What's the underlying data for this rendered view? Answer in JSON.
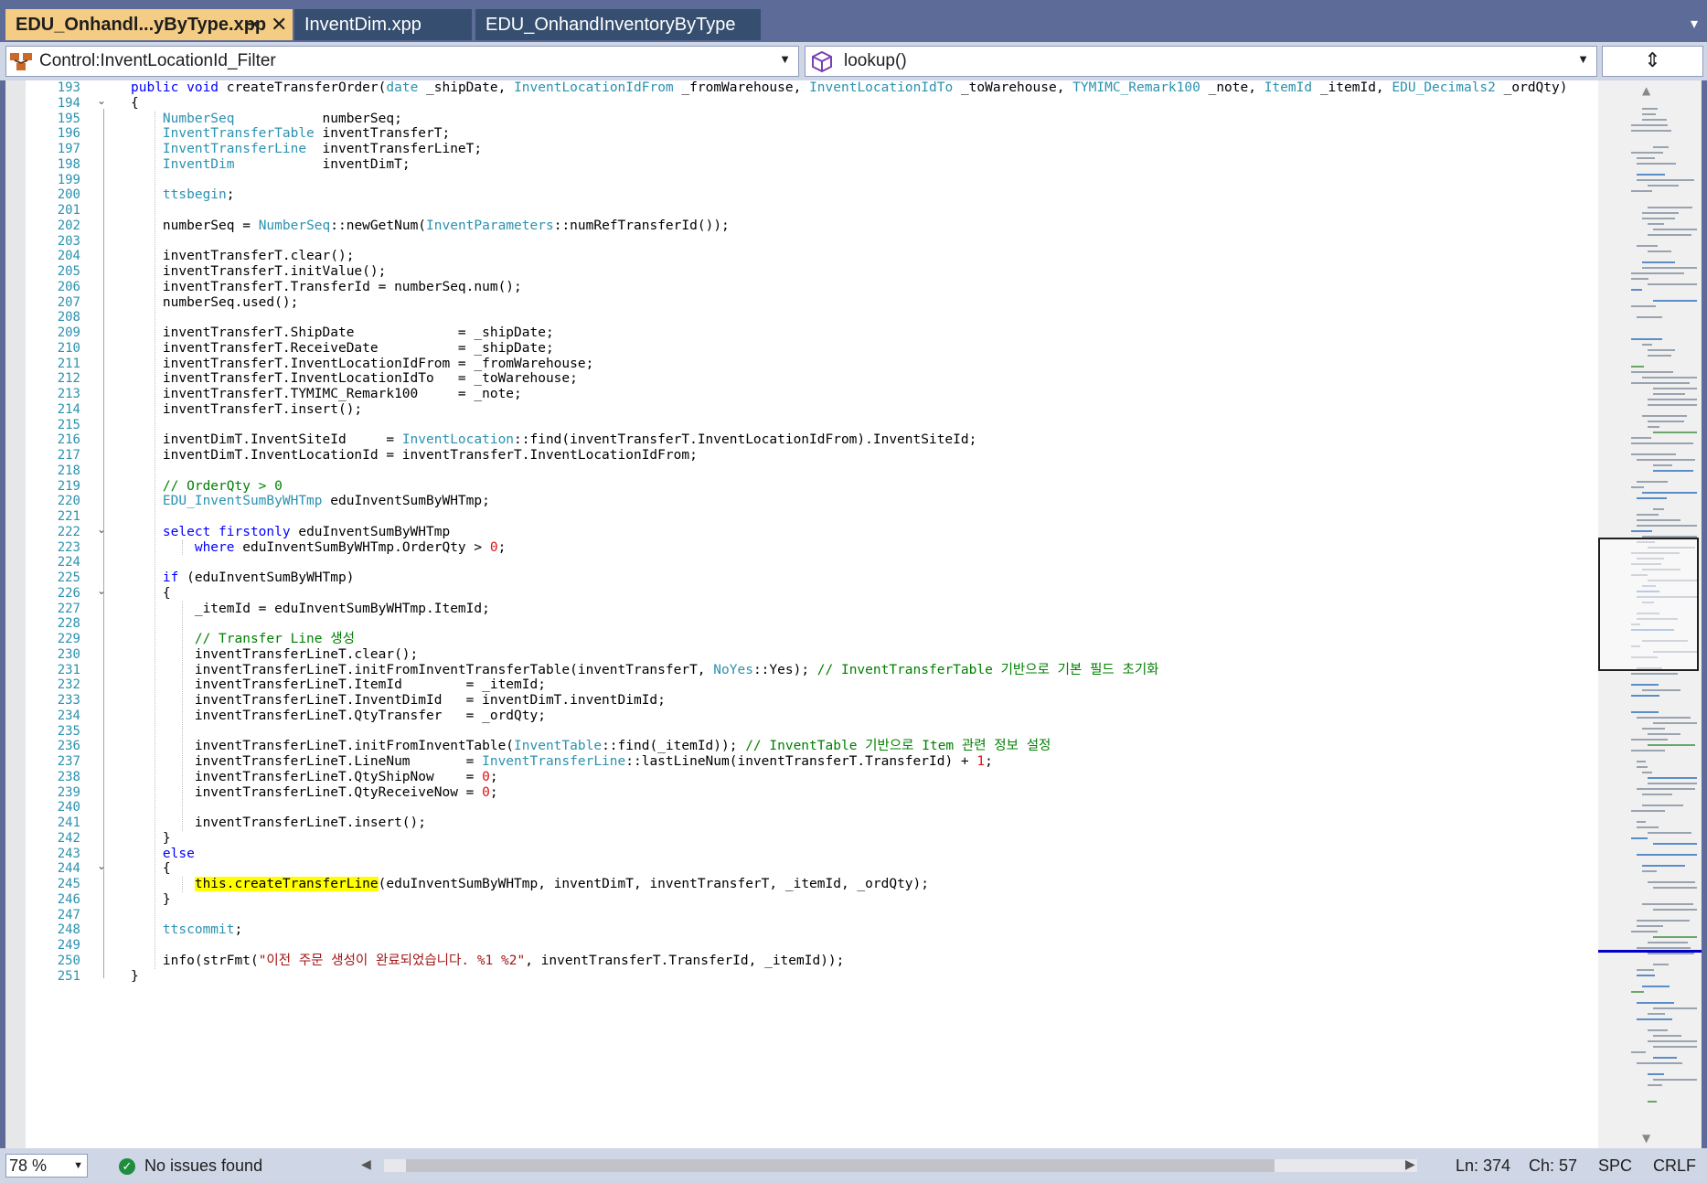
{
  "tabs": [
    {
      "label": "EDU_Onhandl...yByType.xpp",
      "active": true,
      "pin_icon": "pin-icon",
      "close_icon": "close-icon"
    },
    {
      "label": "InventDim.xpp",
      "active": false
    },
    {
      "label": "EDU_OnhandInventoryByType",
      "active": false
    }
  ],
  "nav": {
    "left_combo": "Control:InventLocationId_Filter",
    "right_combo": "lookup()",
    "split_icon": "split-icon"
  },
  "colors": {
    "active_tab": "#f5cc84",
    "tab_strip": "#5d6b99",
    "keyword": "#0000ff",
    "type": "#2b91af",
    "comment": "#008000",
    "string": "#a31515",
    "number": "#e01010",
    "highlight": "#ffff00"
  },
  "code": {
    "first_line_number": 193,
    "lines": [
      [
        [
          "kw",
          "public void "
        ],
        [
          "",
          "createTransferOrder("
        ],
        [
          "ty",
          "date"
        ],
        [
          "",
          " _shipDate, "
        ],
        [
          "ty",
          "InventLocationIdFrom"
        ],
        [
          "",
          " _fromWarehouse, "
        ],
        [
          "ty",
          "InventLocationIdTo"
        ],
        [
          "",
          " _toWarehouse, "
        ],
        [
          "ty",
          "TYMIMC_Remark100"
        ],
        [
          "",
          " _note, "
        ],
        [
          "ty",
          "ItemId"
        ],
        [
          "",
          " _itemId, "
        ],
        [
          "ty",
          "EDU_Decimals2"
        ],
        [
          "",
          " _ordQty)"
        ]
      ],
      [
        [
          "",
          "{"
        ]
      ],
      [
        [
          "",
          "    "
        ],
        [
          "ty",
          "NumberSeq"
        ],
        [
          "",
          "           numberSeq;"
        ]
      ],
      [
        [
          "",
          "    "
        ],
        [
          "ty",
          "InventTransferTable"
        ],
        [
          "",
          " inventTransferT;"
        ]
      ],
      [
        [
          "",
          "    "
        ],
        [
          "ty",
          "InventTransferLine"
        ],
        [
          "",
          "  inventTransferLineT;"
        ]
      ],
      [
        [
          "",
          "    "
        ],
        [
          "ty",
          "InventDim"
        ],
        [
          "",
          "           inventDimT;"
        ]
      ],
      [],
      [
        [
          "",
          "    "
        ],
        [
          "ty",
          "ttsbegin"
        ],
        [
          "",
          ";"
        ]
      ],
      [],
      [
        [
          "",
          "    numberSeq = "
        ],
        [
          "ty",
          "NumberSeq"
        ],
        [
          "",
          "::newGetNum("
        ],
        [
          "ty",
          "InventParameters"
        ],
        [
          "",
          "::numRefTransferId());"
        ]
      ],
      [],
      [
        [
          "",
          "    inventTransferT.clear();"
        ]
      ],
      [
        [
          "",
          "    inventTransferT.initValue();"
        ]
      ],
      [
        [
          "",
          "    inventTransferT.TransferId = numberSeq.num();"
        ]
      ],
      [
        [
          "",
          "    numberSeq.used();"
        ]
      ],
      [],
      [
        [
          "",
          "    inventTransferT.ShipDate             = _shipDate;"
        ]
      ],
      [
        [
          "",
          "    inventTransferT.ReceiveDate          = _shipDate;"
        ]
      ],
      [
        [
          "",
          "    inventTransferT.InventLocationIdFrom = _fromWarehouse;"
        ]
      ],
      [
        [
          "",
          "    inventTransferT.InventLocationIdTo   = _toWarehouse;"
        ]
      ],
      [
        [
          "",
          "    inventTransferT.TYMIMC_Remark100     = _note;"
        ]
      ],
      [
        [
          "",
          "    inventTransferT.insert();"
        ]
      ],
      [],
      [
        [
          "",
          "    inventDimT.InventSiteId     = "
        ],
        [
          "ty",
          "InventLocation"
        ],
        [
          "",
          "::find(inventTransferT.InventLocationIdFrom).InventSiteId;"
        ]
      ],
      [
        [
          "",
          "    inventDimT.InventLocationId = inventTransferT.InventLocationIdFrom;"
        ]
      ],
      [],
      [
        [
          "",
          "    "
        ],
        [
          "cm",
          "// OrderQty > 0"
        ]
      ],
      [
        [
          "",
          "    "
        ],
        [
          "ty",
          "EDU_InventSumByWHTmp"
        ],
        [
          "",
          " eduInventSumByWHTmp;"
        ]
      ],
      [],
      [
        [
          "",
          "    "
        ],
        [
          "kw",
          "select firstonly"
        ],
        [
          "",
          " eduInventSumByWHTmp"
        ]
      ],
      [
        [
          "",
          "        "
        ],
        [
          "kw",
          "where"
        ],
        [
          "",
          " eduInventSumByWHTmp.OrderQty > "
        ],
        [
          "nu",
          "0"
        ],
        [
          "",
          ";"
        ]
      ],
      [],
      [
        [
          "",
          "    "
        ],
        [
          "kw",
          "if"
        ],
        [
          "",
          " (eduInventSumByWHTmp)"
        ]
      ],
      [
        [
          "",
          "    {"
        ]
      ],
      [
        [
          "",
          "        _itemId = eduInventSumByWHTmp.ItemId;"
        ]
      ],
      [],
      [
        [
          "",
          "        "
        ],
        [
          "cm",
          "// Transfer Line 생성"
        ]
      ],
      [
        [
          "",
          "        inventTransferLineT.clear();"
        ]
      ],
      [
        [
          "",
          "        inventTransferLineT.initFromInventTransferTable(inventTransferT, "
        ],
        [
          "ty",
          "NoYes"
        ],
        [
          "",
          "::Yes); "
        ],
        [
          "cm",
          "// InventTransferTable 기반으로 기본 필드 초기화"
        ]
      ],
      [
        [
          "",
          "        inventTransferLineT.ItemId        = _itemId;"
        ]
      ],
      [
        [
          "",
          "        inventTransferLineT.InventDimId   = inventDimT.inventDimId;"
        ]
      ],
      [
        [
          "",
          "        inventTransferLineT.QtyTransfer   = _ordQty;"
        ]
      ],
      [],
      [
        [
          "",
          "        inventTransferLineT.initFromInventTable("
        ],
        [
          "ty",
          "InventTable"
        ],
        [
          "",
          "::find(_itemId)); "
        ],
        [
          "cm",
          "// InventTable 기반으로 Item 관련 정보 설정"
        ]
      ],
      [
        [
          "",
          "        inventTransferLineT.LineNum       = "
        ],
        [
          "ty",
          "InventTransferLine"
        ],
        [
          "",
          "::lastLineNum(inventTransferT.TransferId) + "
        ],
        [
          "nu",
          "1"
        ],
        [
          "",
          ";"
        ]
      ],
      [
        [
          "",
          "        inventTransferLineT.QtyShipNow    = "
        ],
        [
          "nu",
          "0"
        ],
        [
          "",
          ";"
        ]
      ],
      [
        [
          "",
          "        inventTransferLineT.QtyReceiveNow = "
        ],
        [
          "nu",
          "0"
        ],
        [
          "",
          ";"
        ]
      ],
      [],
      [
        [
          "",
          "        inventTransferLineT.insert();"
        ]
      ],
      [
        [
          "",
          "    }"
        ]
      ],
      [
        [
          "",
          "    "
        ],
        [
          "kw",
          "else"
        ]
      ],
      [
        [
          "",
          "    {"
        ]
      ],
      [
        [
          "",
          "        "
        ],
        [
          "hl",
          "this.createTransferLine"
        ],
        [
          "",
          "(eduInventSumByWHTmp, inventDimT, inventTransferT, _itemId, _ordQty);"
        ]
      ],
      [
        [
          "",
          "    }"
        ]
      ],
      [],
      [
        [
          "",
          "    "
        ],
        [
          "ty",
          "ttscommit"
        ],
        [
          "",
          ";"
        ]
      ],
      [],
      [
        [
          "",
          "    info(strFmt("
        ],
        [
          "st",
          "\"이전 주문 생성이 완료되었습니다. %1 %2\""
        ],
        [
          "",
          ", inventTransferT.TransferId, _itemId));"
        ]
      ],
      [
        [
          "",
          "}"
        ]
      ]
    ],
    "fold_markers": [
      194,
      222,
      226,
      244
    ]
  },
  "status": {
    "zoom": "78 %",
    "issues": "No issues found",
    "issues_icon": "check-circle-icon",
    "line": "Ln: 374",
    "col": "Ch: 57",
    "indent": "SPC",
    "eol": "CRLF"
  }
}
